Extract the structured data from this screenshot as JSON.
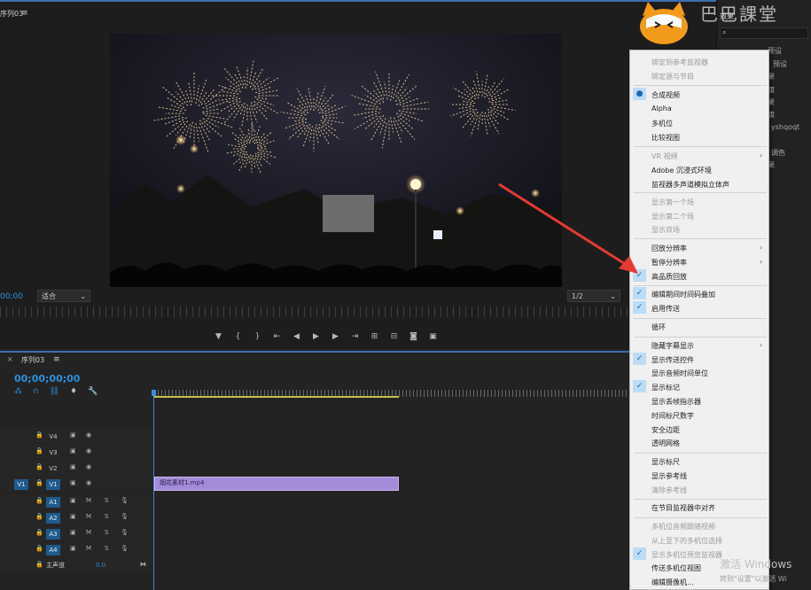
{
  "monitor": {
    "tab_label": "序列03",
    "menu_icon": "≡",
    "timecode": "00;00",
    "zoom": "适合",
    "resolution": "1/2"
  },
  "transport_icons": [
    "mark-in-icon",
    "mark-bracket-in-icon",
    "mark-bracket-out-icon",
    "go-to-in-icon",
    "step-back-icon",
    "play-icon",
    "step-forward-icon",
    "go-to-out-icon",
    "insert-icon",
    "overwrite-icon",
    "export-frame-icon",
    "button-editor-icon"
  ],
  "effects": {
    "title": "效果",
    "items": [
      "预设",
      "预设",
      "果",
      "渡",
      "果",
      "渡",
      "yshqoqt",
      "调色",
      "果"
    ]
  },
  "watermark": "巴巴課堂",
  "timeline": {
    "tab_label": "序列03",
    "timecode": "00;00;00;00",
    "video_tracks": [
      {
        "name": "V4",
        "src": ""
      },
      {
        "name": "V3",
        "src": ""
      },
      {
        "name": "V2",
        "src": ""
      },
      {
        "name": "V1",
        "src": "V1"
      }
    ],
    "audio_tracks": [
      {
        "name": "A1",
        "src": ""
      },
      {
        "name": "A2",
        "src": ""
      },
      {
        "name": "A3",
        "src": ""
      },
      {
        "name": "A4",
        "src": ""
      }
    ],
    "mute_label": "M",
    "solo_label": "S",
    "master_label": "主声道",
    "master_value": "0.0",
    "clip_label": "烟花素材1.mp4"
  },
  "menu": {
    "items": [
      {
        "label": "绑定到参考监视器",
        "disabled": true
      },
      {
        "label": "绑定源与节目",
        "disabled": true
      },
      {
        "label": "合成视频",
        "mark": "●"
      },
      {
        "label": "Alpha"
      },
      {
        "label": "多机位"
      },
      {
        "label": "比较视图"
      },
      {
        "label": "VR 视频",
        "disabled": true,
        "submenu": true
      },
      {
        "label": "Adobe 沉浸式环境"
      },
      {
        "label": "监视器多声道模拟立体声"
      },
      {
        "label": "显示第一个场",
        "disabled": true
      },
      {
        "label": "显示第二个场",
        "disabled": true
      },
      {
        "label": "显示双场",
        "disabled": true
      },
      {
        "label": "回放分辨率",
        "submenu": true
      },
      {
        "label": "暂停分辨率",
        "submenu": true
      },
      {
        "label": "高品质回放",
        "mark": "✓"
      },
      {
        "label": "编辑期间时间码叠加",
        "mark": "✓"
      },
      {
        "label": "启用传送",
        "mark": "✓"
      },
      {
        "label": "循环"
      },
      {
        "label": "隐藏字幕显示",
        "submenu": true
      },
      {
        "label": "显示传送控件",
        "mark": "✓"
      },
      {
        "label": "显示音频时间单位"
      },
      {
        "label": "显示标记",
        "mark": "✓"
      },
      {
        "label": "显示丢帧指示器"
      },
      {
        "label": "时间标尺数字"
      },
      {
        "label": "安全边距"
      },
      {
        "label": "透明网格"
      },
      {
        "label": "显示标尺"
      },
      {
        "label": "显示参考线"
      },
      {
        "label": "清除参考线",
        "disabled": true
      },
      {
        "label": "在节目监视器中对齐"
      },
      {
        "label": "多机位音频跟随视频",
        "disabled": true
      },
      {
        "label": "从上至下的多机位选择",
        "disabled": true
      },
      {
        "label": "显示多机位预览监视器",
        "disabled": true,
        "mark": "✓"
      },
      {
        "label": "传送多机位视图"
      },
      {
        "label": "编辑摄像机..."
      }
    ]
  },
  "activation": {
    "line1": "激活 Windows",
    "line2": "转到\"设置\"以激活 Wi"
  },
  "colors": {
    "accent": "#3d6fb0",
    "timecode": "#2f8fdb",
    "clip": "#a48ad8",
    "check_bg": "#bcdcf5",
    "annotation_arrow": "#e53935"
  }
}
